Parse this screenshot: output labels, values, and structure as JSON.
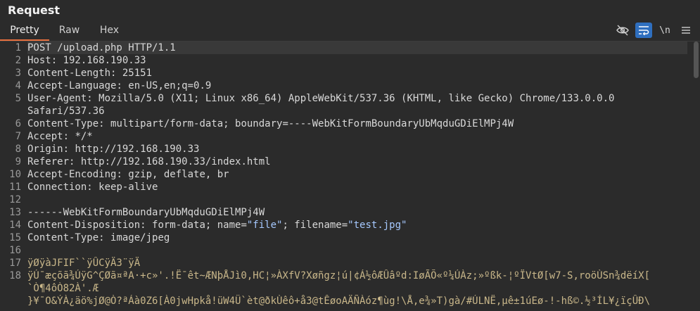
{
  "panel": {
    "title": "Request"
  },
  "tabs": [
    {
      "label": "Pretty",
      "active": true
    },
    {
      "label": "Raw",
      "active": false
    },
    {
      "label": "Hex",
      "active": false
    }
  ],
  "toolbar": {
    "hide_icon": "eye-slash-icon",
    "wrap_icon": "word-wrap-icon",
    "newline_label": "\\n",
    "menu_icon": "hamburger-menu-icon",
    "accent": "#e8713f",
    "active_tool": "#2f6fbf"
  },
  "lines": [
    {
      "n": "1",
      "text": "POST /upload.php HTTP/1.1"
    },
    {
      "n": "2",
      "key": "Host",
      "val": "192.168.190.33"
    },
    {
      "n": "3",
      "key": "Content-Length",
      "val": "25151"
    },
    {
      "n": "4",
      "key": "Accept-Language",
      "val": "en-US,en;q=0.9"
    },
    {
      "n": "5",
      "key": "User-Agent",
      "val": "Mozilla/5.0 (X11; Linux x86_64) AppleWebKit/537.36 (KHTML, like Gecko) Chrome/133.0.0.0",
      "cont": "Safari/537.36"
    },
    {
      "n": "6",
      "key": "Content-Type",
      "val": "multipart/form-data; boundary=----WebKitFormBoundaryUbMqduGDiElMPj4W"
    },
    {
      "n": "7",
      "key": "Accept",
      "val": "*/*"
    },
    {
      "n": "8",
      "key": "Origin",
      "val": "http://192.168.190.33"
    },
    {
      "n": "9",
      "key": "Referer",
      "val": "http://192.168.190.33/index.html"
    },
    {
      "n": "10",
      "key": "Accept-Encoding",
      "val": "gzip, deflate, br"
    },
    {
      "n": "11",
      "key": "Connection",
      "val": "keep-alive"
    },
    {
      "n": "12",
      "text": ""
    },
    {
      "n": "13",
      "text": "------WebKitFormBoundaryUbMqduGDiElMPj4W"
    },
    {
      "n": "14",
      "key": "Content-Disposition",
      "pre": "form-data; name=",
      "q1": "\"file\"",
      "mid": "; filename=",
      "q2": "\"test.jpg\""
    },
    {
      "n": "15",
      "key": "Content-Type",
      "val": "image/jpeg"
    },
    {
      "n": "16",
      "text": ""
    },
    {
      "n": "17",
      "text": "ÿØÿàJFIF``ÿÛCÿÄ3¨ÿÄ"
    },
    {
      "n": "18",
      "text": "ÿÚ¯æçõã¾ÚÿG^ÇØã¤ªA·+c»'.!Ë¯êt~ÆNþÅJì0,HC¦»ÀXfV?Xøñgz¦ú|¢Á½ôÆÛâºd:IøÃÕ«º¼ÚÀz;»ºßk-¦ºÏVtØ[w7-S,roöÙSn¾dëíX[",
      "cont": "`Ò¶4ôÒ82À'.Æ",
      "cont2": "}¥¯O&ÝÀ¿äö%jØ@Ò?ªÁà0Z6[À0jwHpkå!üW4Ü`èt@ðkÙêô+å3@tÊøoAÄÑÀóz¶ùg!\\Å,e¾»T)gà/#ÚLNË,µê±1úEø-!-hß©.½³ÍL¥¿ïçÛÐ\\"
    }
  ]
}
